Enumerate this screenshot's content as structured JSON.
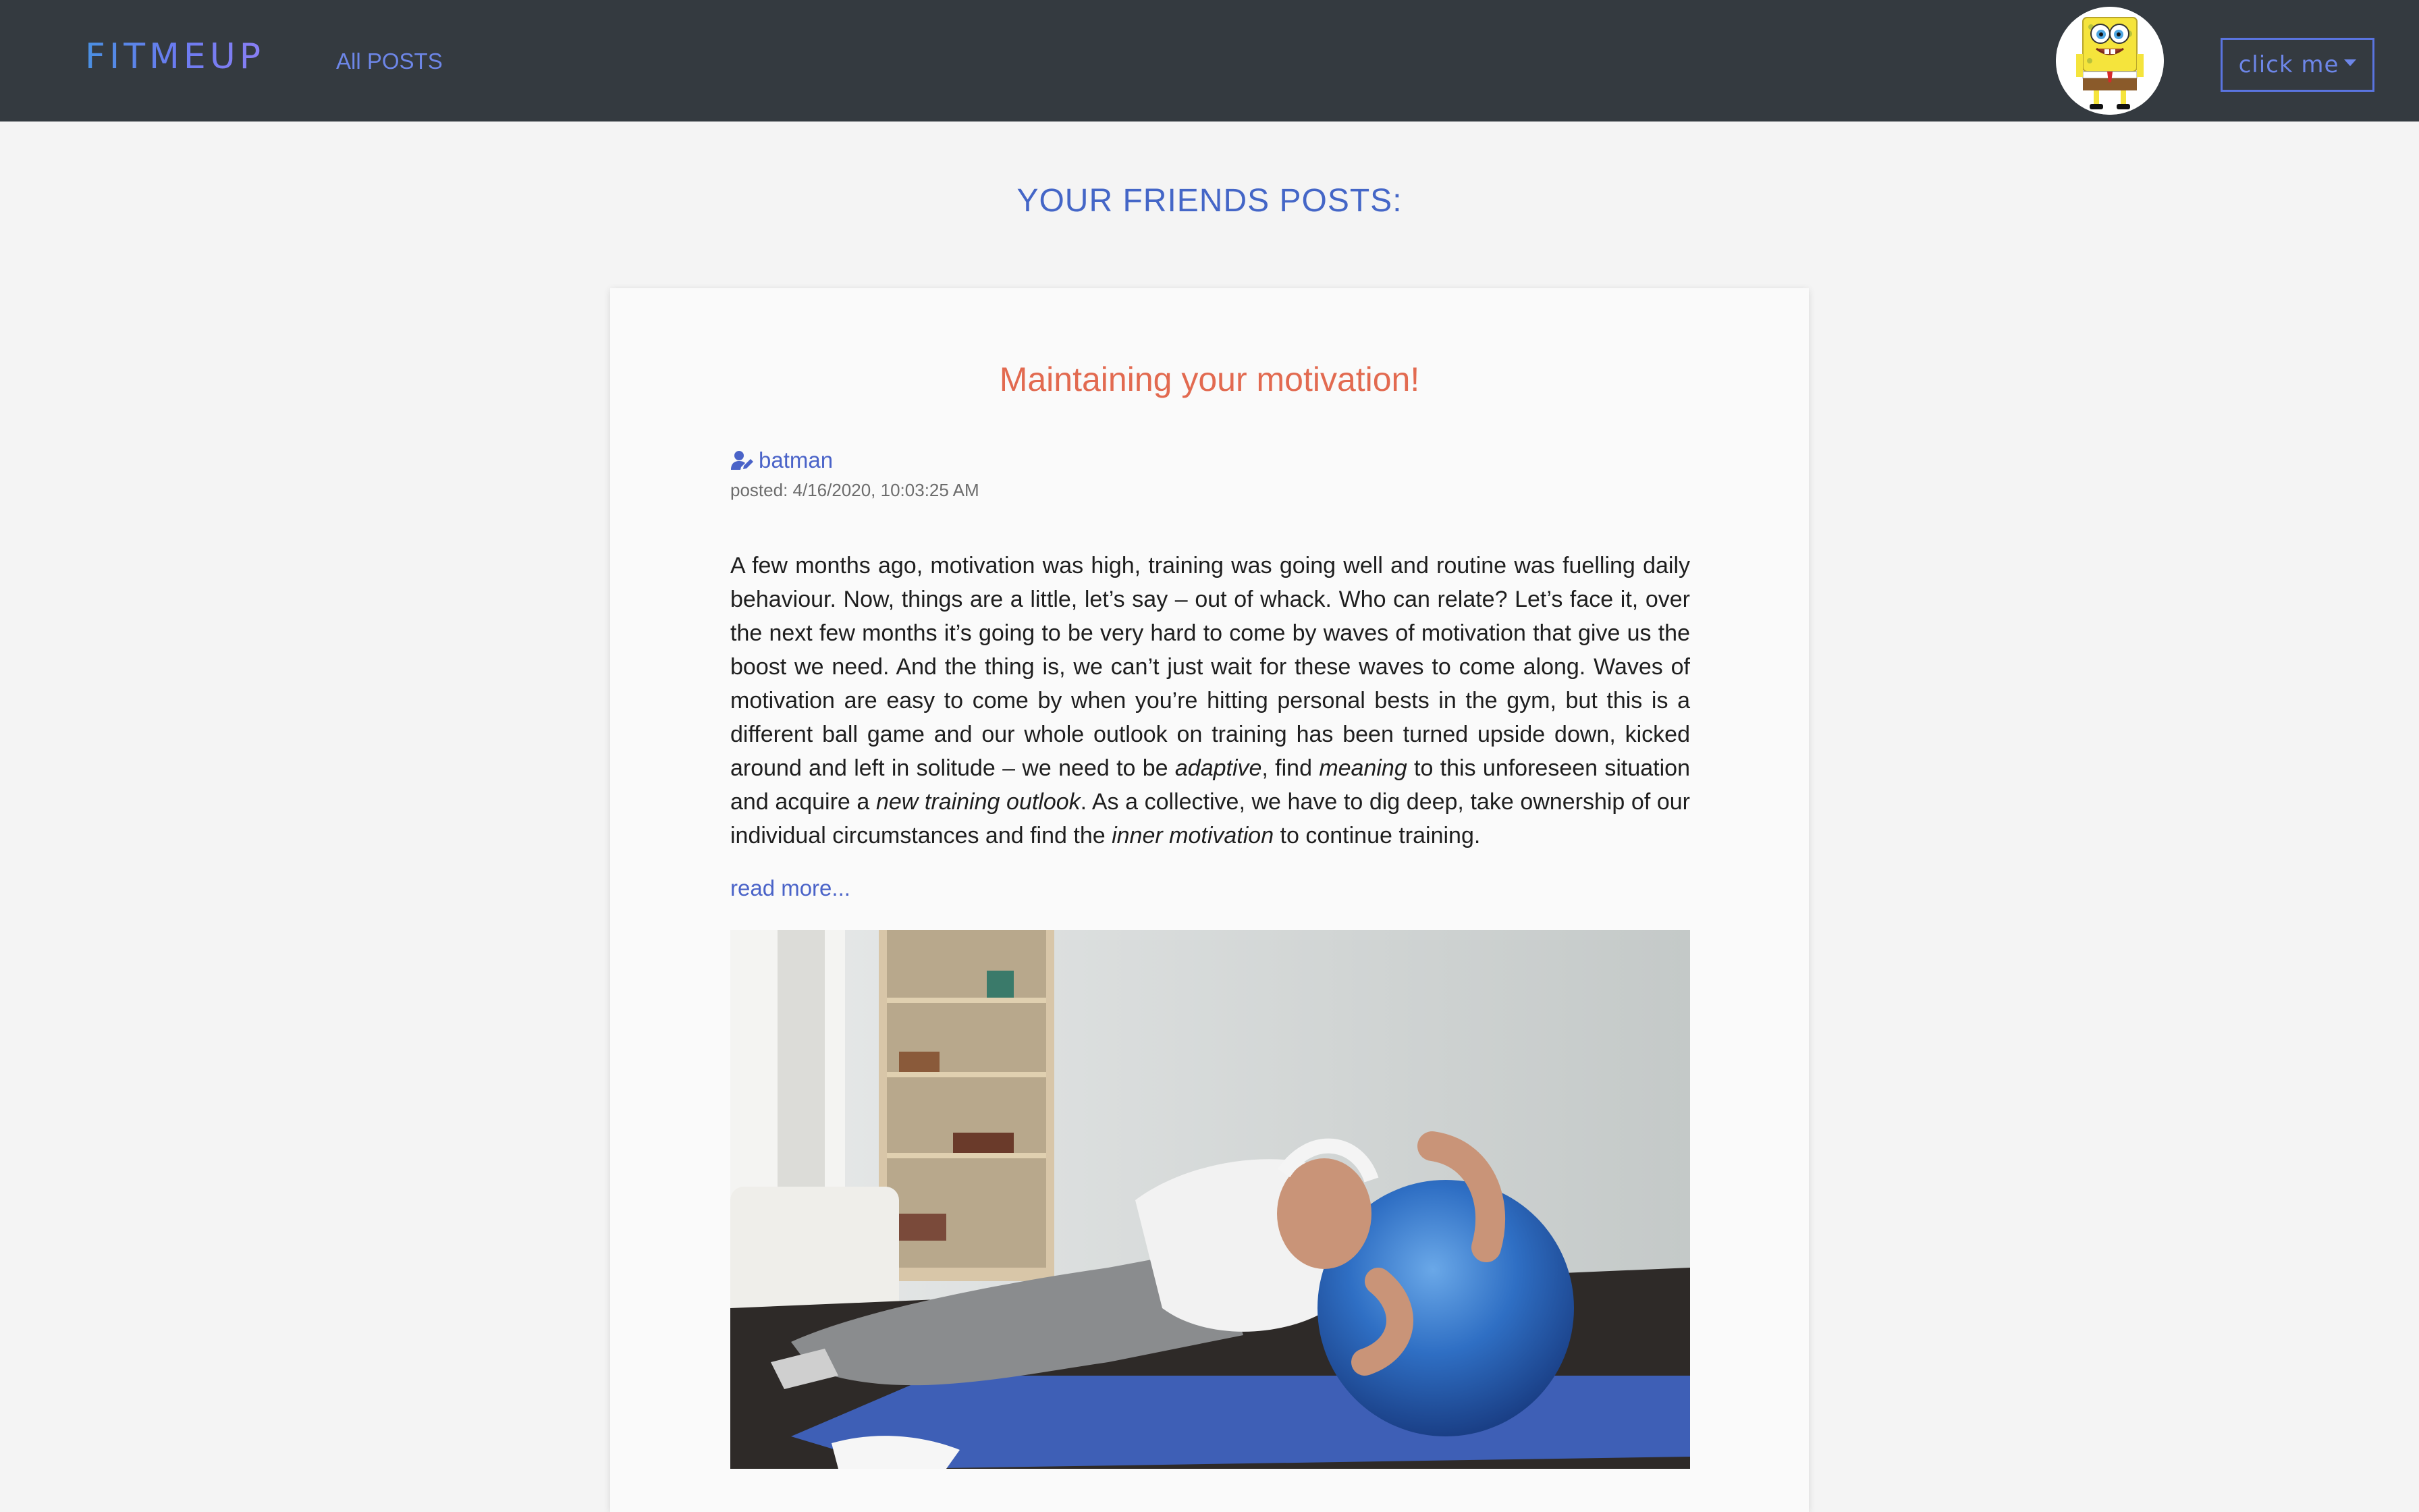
{
  "navbar": {
    "brand": "FITMEUP",
    "nav_link": "All POSTS",
    "dropdown_label": "click me"
  },
  "page": {
    "section_title": "YOUR FRIENDS POSTS:"
  },
  "post": {
    "title": "Maintaining your motivation!",
    "author": "batman",
    "posted": "posted: 4/16/2020, 10:03:25 AM",
    "body": {
      "p1": "A few months ago, motivation was high, training was going well and routine was fuelling daily behaviour. Now, things are a little, let’s say – out of whack. Who can relate? Let’s face it, over the next few months it’s going to be very hard to come by waves of motivation that give us the boost we need. And the thing is, we can’t just wait for these waves to come along. Waves of motivation are easy to come by when you’re hitting personal bests in the gym, but this is a different ball game and our whole outlook on training has been turned upside down, kicked around and left in solitude – we need to be ",
      "em1": "adaptive",
      "p2": ", find ",
      "em2": "meaning",
      "p3": " to this unforeseen situation and acquire a ",
      "em3": "new training outlook",
      "p4": ". As a collective, we have to dig deep, take ownership of our individual circumstances and find the ",
      "em4": "inner motivation",
      "p5": " to continue training."
    },
    "read_more": "read more..."
  },
  "icons": {
    "author": "user-edit-icon",
    "dropdown": "caret-down-icon"
  },
  "colors": {
    "navbar_bg": "#343a40",
    "accent": "#4466c7",
    "title": "#e26a50"
  }
}
